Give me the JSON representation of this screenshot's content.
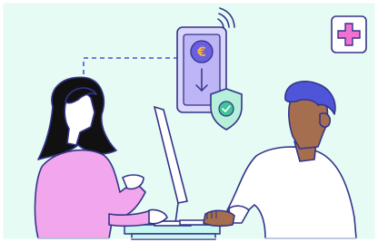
{
  "phone": {
    "currency_symbol": "€"
  },
  "colors": {
    "background": "#e6fbf3",
    "outline": "#33348a",
    "phone_fill": "#d9d5fb",
    "phone_screen": "#bdb5f5",
    "coin": "#6a5fe0",
    "coin_symbol": "#f7b53a",
    "shield": "#b7f0da",
    "check": "#3ec59a",
    "cross": "#ef72d3",
    "woman_shirt": "#f2a6ec",
    "woman_hair": "#111111",
    "man_hair": "#4f55d8",
    "man_skin": "#a56f4f",
    "man_shirt": "#ffffff",
    "woman_skin": "#ffffff",
    "desk": "#c8f6f0"
  },
  "icons": [
    "wifi-icon",
    "euro-coin-icon",
    "arrow-down-icon",
    "shield-check-icon",
    "medical-cross-icon"
  ]
}
